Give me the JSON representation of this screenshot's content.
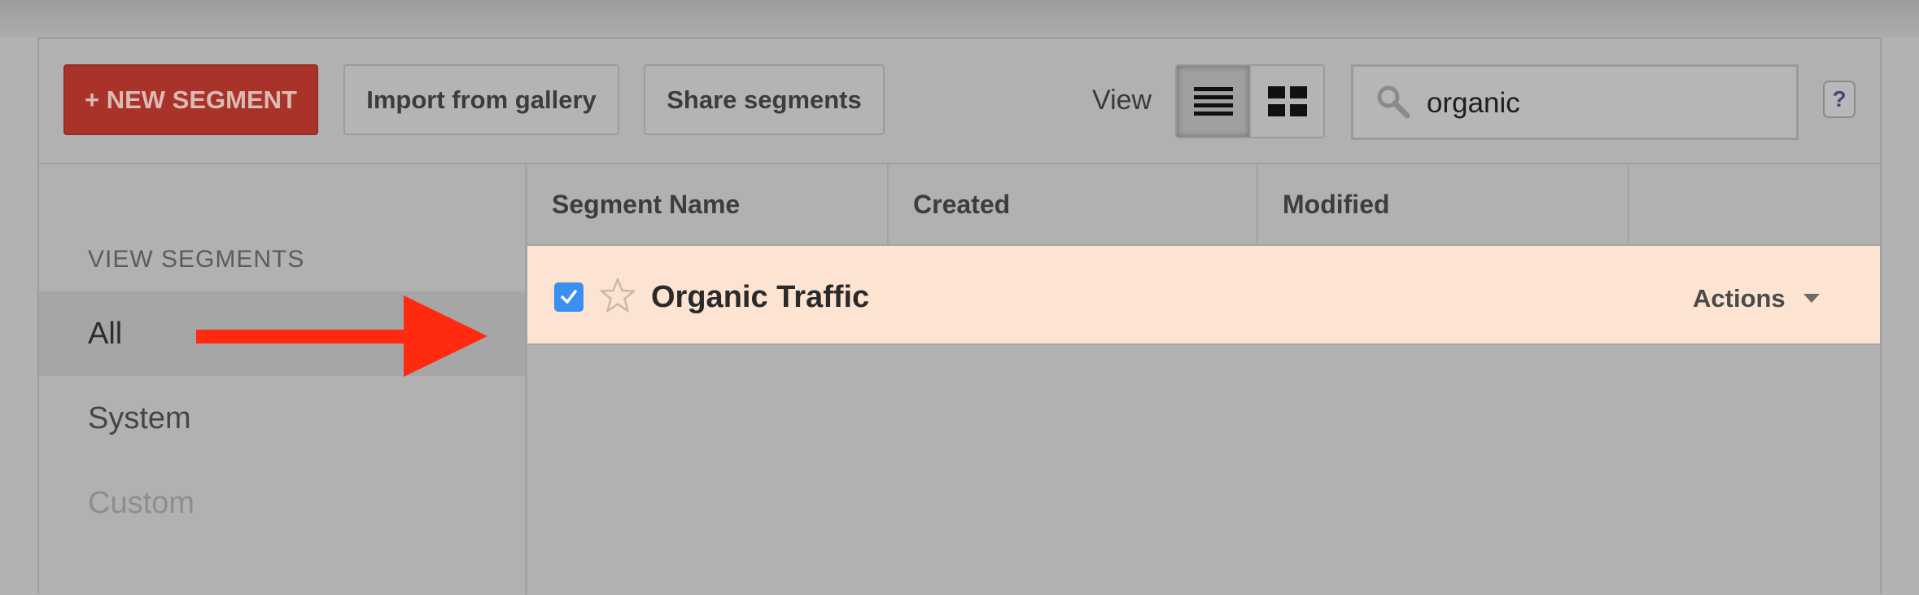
{
  "toolbar": {
    "new_segment_label": "+ NEW SEGMENT",
    "import_label": "Import from gallery",
    "share_label": "Share segments",
    "view_label": "View",
    "search_value": "organic",
    "help_label": "?"
  },
  "sidebar": {
    "title": "VIEW SEGMENTS",
    "items": [
      {
        "label": "All",
        "selected": true
      },
      {
        "label": "System"
      },
      {
        "label": "Custom"
      }
    ]
  },
  "table": {
    "columns": [
      "Segment Name",
      "Created",
      "Modified",
      ""
    ],
    "rows": [
      {
        "name": "Organic Traffic",
        "checked": true,
        "starred": false,
        "actions_label": "Actions"
      }
    ]
  },
  "colors": {
    "new_segment_button": "#a93328",
    "row_highlight": "#fde3d1",
    "checkbox": "#3a8ff0",
    "annotation_arrow": "#ff2a10"
  },
  "icons": {
    "search": "search-icon",
    "list_view": "list-view-icon",
    "grid_view": "grid-view-icon",
    "star": "star-icon",
    "caret": "caret-down-icon",
    "arrow": "arrow-right-icon"
  }
}
